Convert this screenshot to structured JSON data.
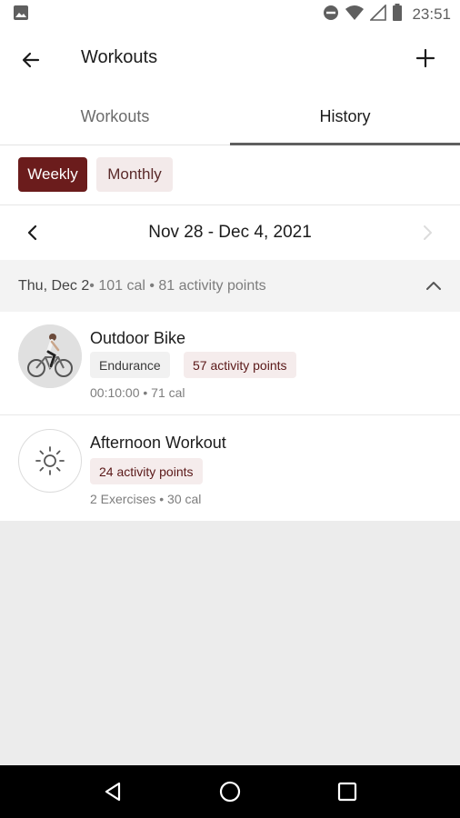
{
  "status_bar": {
    "time": "23:51",
    "icons": [
      "image-icon",
      "do-not-disturb-icon",
      "wifi-icon",
      "signal-icon",
      "battery-icon"
    ]
  },
  "app_bar": {
    "title": "Workouts",
    "back_icon": "arrow-back-icon",
    "add_icon": "plus-icon"
  },
  "tabs": [
    {
      "label": "Workouts",
      "active": false
    },
    {
      "label": "History",
      "active": true
    }
  ],
  "period_toggle": {
    "weekly_label": "Weekly",
    "monthly_label": "Monthly",
    "selected": "Weekly"
  },
  "date_nav": {
    "range": "Nov 28 - Dec 4, 2021"
  },
  "day_group": {
    "day": "Thu, Dec 2",
    "summary": " • 101 cal • 81 activity points"
  },
  "workouts": [
    {
      "title": "Outdoor Bike",
      "tags": [
        "Endurance",
        "57 activity points"
      ],
      "meta": "00:10:00 • 71 cal",
      "icon": "cyclist-icon"
    },
    {
      "title": "Afternoon Workout",
      "tags": [
        "24 activity points"
      ],
      "meta": "2 Exercises • 30 cal",
      "icon": "sun-icon"
    }
  ],
  "colors": {
    "accent": "#6b1c1c",
    "chip_light": "#f3eaea",
    "tag_red_bg": "#f5ecec",
    "empty_bg": "#ececec"
  }
}
